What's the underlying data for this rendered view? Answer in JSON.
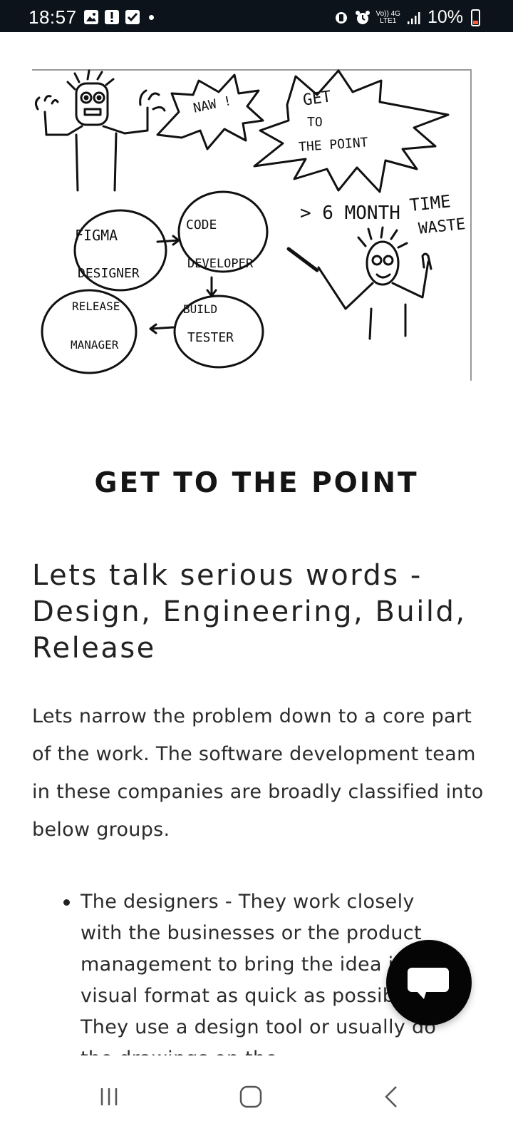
{
  "status_bar": {
    "time": "18:57",
    "network_top": "Vo)) 4G",
    "network_bottom": "LTE1",
    "battery_percent": "10%",
    "left_icons": [
      "gallery-icon",
      "alert-icon",
      "check-icon",
      "dot-icon"
    ],
    "right_icons": [
      "battery-saver-icon",
      "alarm-icon",
      "signal-icon"
    ],
    "battery_level": 0.1,
    "battery_color": "#ff5a3a"
  },
  "illustration": {
    "texts": {
      "naw": "NAW !",
      "get": "GET",
      "to": "TO",
      "the_point": "THE POINT",
      "six_month": "> 6 MONTH",
      "time": "TIME",
      "waste": "WASTE",
      "figma": "FIGMA",
      "designer": "DESIGNER",
      "code": "CODE",
      "developer": "DEVELOPER",
      "build": "BUILD",
      "tester": "TESTER",
      "release": "RELEASE",
      "manager": "MANAGER"
    }
  },
  "article": {
    "headline": "GET TO THE POINT",
    "subheading": "Lets talk serious words - Design, Engineering, Build, Release",
    "paragraph": "Lets narrow the problem down to a core part of the work. The software development team in these companies are broadly classified into below groups.",
    "bullets": [
      "The designers - They work closely with the businesses or the product management to bring the idea into a visual format as quick as possible. They use a design tool or usually do the drawings on the"
    ]
  },
  "chat_button": {
    "icon": "chat-bubble-icon"
  },
  "nav_bar": {
    "icons": [
      "recent-apps-icon",
      "home-icon",
      "back-icon"
    ]
  }
}
